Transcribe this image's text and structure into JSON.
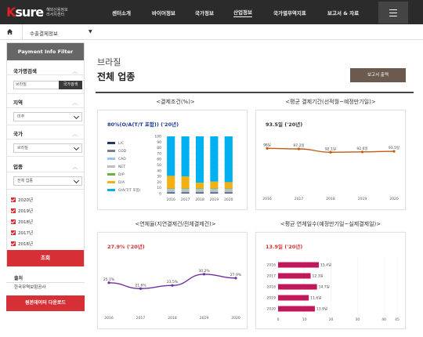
{
  "logo": {
    "mark_k": "K",
    "mark_rest": "sure",
    "line1": "해외신용정보",
    "line2": "리서치센터"
  },
  "nav": {
    "items": [
      "센터소개",
      "바이어정보",
      "국가정보",
      "산업정보",
      "국가별무역지표",
      "보고서 & 자료"
    ],
    "active": "산업정보"
  },
  "breadcrumb": {
    "label": "수출결제정보"
  },
  "sidebar": {
    "title": "Payment Info Filter",
    "country_search": {
      "label": "국가명검색",
      "value": "브라질",
      "button": "국가검색"
    },
    "region": {
      "label": "지역",
      "value": "미주"
    },
    "country": {
      "label": "국가",
      "value": "브라질"
    },
    "industry": {
      "label": "업종",
      "value": "전체 업종"
    },
    "years": [
      "2020년",
      "2019년",
      "2018년",
      "2017년",
      "2016년"
    ],
    "search_button": "조회",
    "source_label": "출처",
    "source_value": "한국무역보험공사",
    "download_button": "원본데이터 다운로드"
  },
  "header": {
    "country": "브라질",
    "sector": "전체 업종",
    "report_button": "보고서 출력"
  },
  "accent_colors": {
    "red": "#d62f35",
    "dark": "#2b2b2b",
    "brown": "#6b5a4d"
  },
  "chart_data": [
    {
      "type": "bar",
      "title": "<결제조건(%)>",
      "subtitle": "80%(O/A(T/T 포함)) ('20년)",
      "categories": [
        "2016",
        "2017",
        "2018",
        "2019",
        "2020"
      ],
      "ylim": [
        0,
        100
      ],
      "yticks": [
        0,
        10,
        20,
        30,
        40,
        50,
        60,
        70,
        80,
        90,
        100
      ],
      "stacked": true,
      "legend": "left",
      "series": [
        {
          "name": "L/C",
          "color": "#1f3864",
          "values": [
            1,
            1,
            1,
            1,
            1
          ]
        },
        {
          "name": "COD",
          "color": "#7f7f7f",
          "values": [
            2,
            2,
            2,
            2,
            2
          ]
        },
        {
          "name": "CAD",
          "color": "#9dc3e6",
          "values": [
            3,
            3,
            3,
            3,
            3
          ]
        },
        {
          "name": "NET",
          "color": "#bfbfbf",
          "values": [
            2,
            2,
            2,
            2,
            2
          ]
        },
        {
          "name": "D/P",
          "color": "#70ad47",
          "values": [
            1,
            1,
            1,
            1,
            1
          ]
        },
        {
          "name": "D/A",
          "color": "#f2b111",
          "values": [
            22,
            21,
            10,
            12,
            11
          ]
        },
        {
          "name": "O/A(T/T 포함)",
          "color": "#00b0f0",
          "values": [
            69,
            70,
            81,
            79,
            80
          ]
        }
      ]
    },
    {
      "type": "line",
      "title": "<평균 결제기간(선적월~예정만기일)>",
      "subtitle": "93.5일 ('20년)",
      "x": [
        "2016",
        "2017",
        "2018",
        "2019",
        "2020"
      ],
      "values": [
        98,
        97.2,
        92.1,
        92.6,
        93.5
      ],
      "labels": [
        "98일",
        "97.2일",
        "92.1일",
        "92.6일",
        "93.5일"
      ],
      "color": "#c55a11"
    },
    {
      "type": "line",
      "title": "<연체율(지연결제건/전체결제건)>",
      "subtitle": "27.9% ('20년)",
      "x": [
        "2016",
        "2017",
        "2018",
        "2019",
        "2020"
      ],
      "values": [
        25.1,
        21.6,
        23.5,
        30.2,
        27.9
      ],
      "labels": [
        "25.1%",
        "21.6%",
        "23.5%",
        "30.2%",
        "27.9%"
      ],
      "color": "#7030a0"
    },
    {
      "type": "bar",
      "orientation": "horizontal",
      "title": "<평균 연체일수(예정만기일~실제결제일)>",
      "subtitle": "13.9일 ('20년)",
      "categories": [
        "2016",
        "2017",
        "2018",
        "2019",
        "2020"
      ],
      "values": [
        15.4,
        12.3,
        14.7,
        11.6,
        13.9
      ],
      "labels": [
        "15.4일",
        "12.3일",
        "14.7일",
        "11.6일",
        "13.9일"
      ],
      "xticks": [
        0,
        10,
        20,
        30,
        40,
        45
      ],
      "xlim": [
        0,
        45
      ],
      "color": "#c0185a"
    }
  ]
}
